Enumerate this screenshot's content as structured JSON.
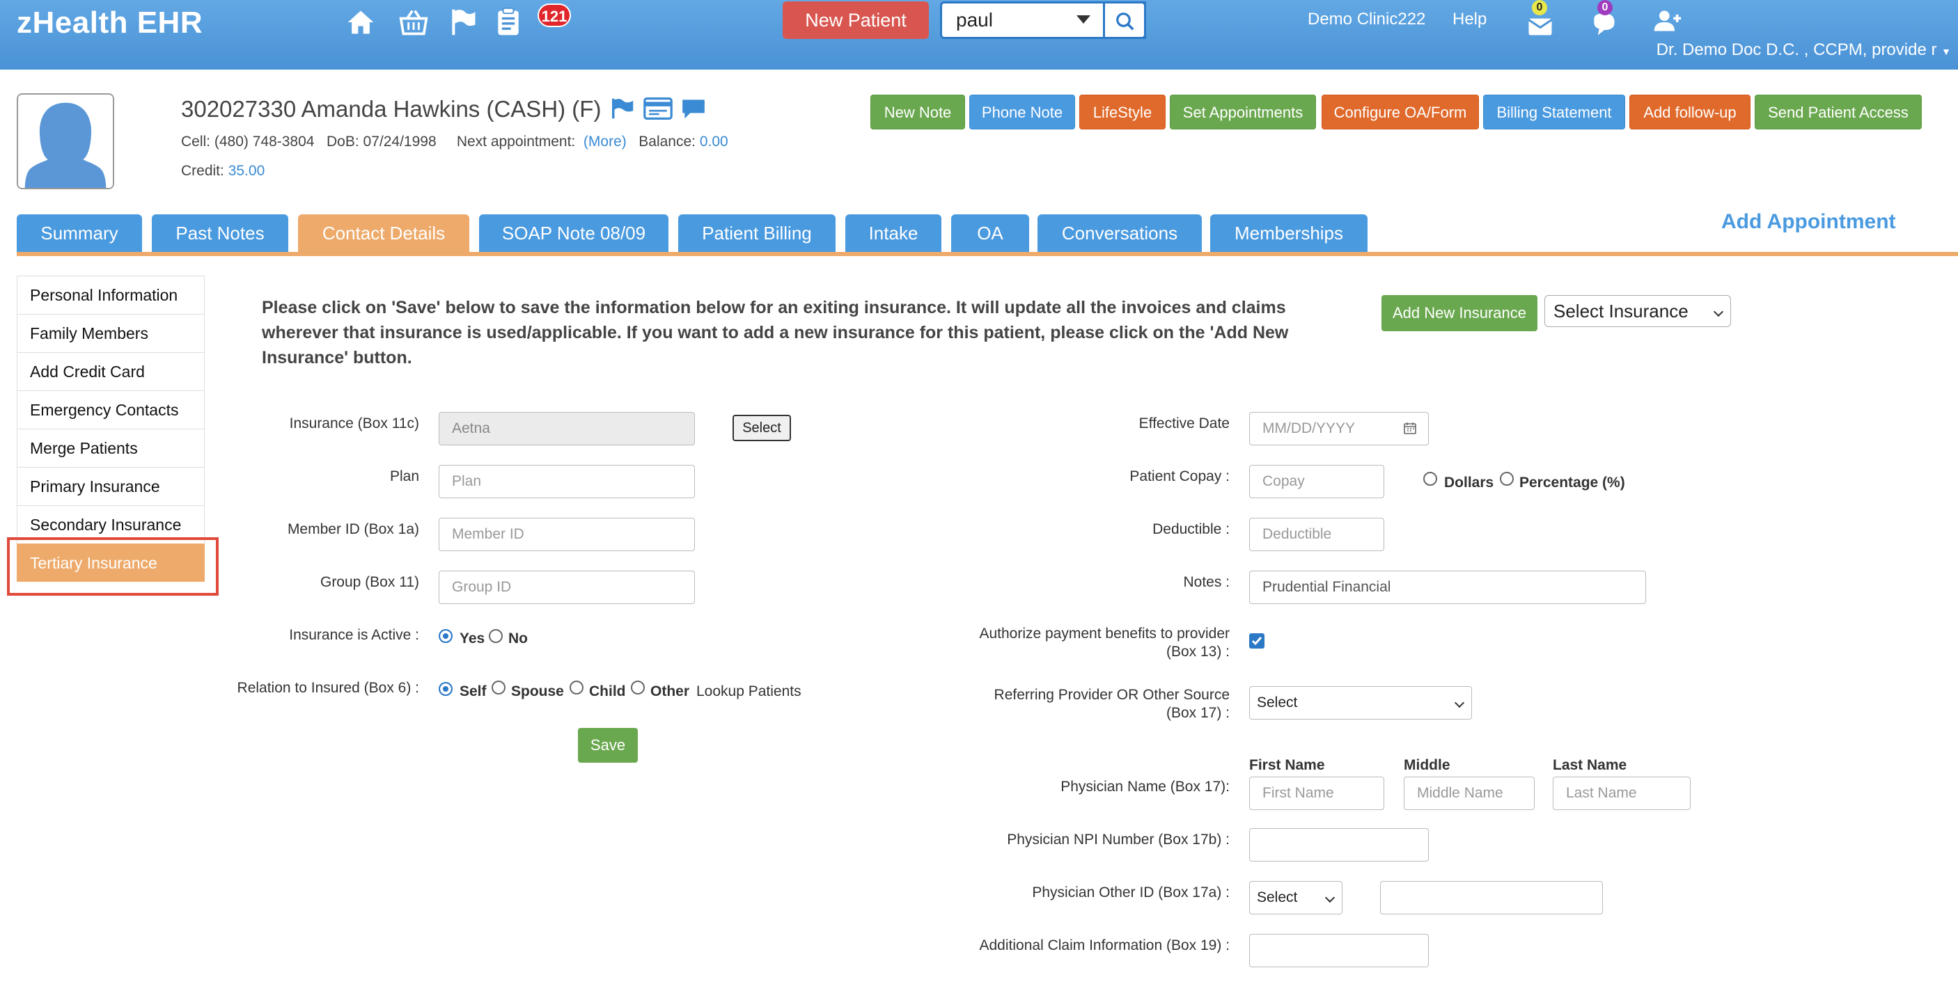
{
  "app": {
    "brand": "zHealth EHR"
  },
  "topbar": {
    "icons": [
      "home-icon",
      "basket-icon",
      "flag-icon",
      "clipboard-icon"
    ],
    "notification_count": "121",
    "new_patient": "New Patient",
    "search_value": "paul",
    "clinic": "Demo Clinic222",
    "help": "Help",
    "mail_count": "0",
    "chat_count": "0",
    "provider": "Dr. Demo Doc D.C. , CCPM, provide r"
  },
  "patient": {
    "header": "302027330 Amanda Hawkins  (CASH) (F)",
    "cell_label": "Cell:",
    "cell": "(480) 748-3804",
    "dob_label": "DoB:",
    "dob": "07/24/1998",
    "next_appt_label": "Next appointment:",
    "next_appt_link": "(More)",
    "balance_label": "Balance:",
    "balance": "0.00",
    "credit_label": "Credit:",
    "credit": "35.00"
  },
  "actions": {
    "new_note": "New Note",
    "phone_note": "Phone Note",
    "lifestyle": "LifeStyle",
    "set_appointments": "Set Appointments",
    "configure": "Configure OA/Form",
    "billing_statement": "Billing Statement",
    "add_followup": "Add follow-up",
    "send_access": "Send Patient Access"
  },
  "tabs": [
    "Summary",
    "Past Notes",
    "Contact Details",
    "SOAP Note 08/09",
    "Patient Billing",
    "Intake",
    "OA",
    "Conversations",
    "Memberships"
  ],
  "add_appointment": "Add Appointment",
  "side_menu": [
    "Personal Information",
    "Family Members",
    "Add Credit Card",
    "Emergency Contacts",
    "Merge Patients",
    "Primary Insurance",
    "Secondary Insurance",
    "Tertiary Insurance"
  ],
  "instructions": "Please click on 'Save' below to save the information below for an exiting insurance. It will update all the invoices and claims wherever that insurance is used/applicable. If you want to add a new insurance for this patient, please click on the 'Add New Insurance' button.",
  "add_new_insurance": "Add New Insurance",
  "select_insurance": "Select Insurance",
  "form_left": {
    "insurance_label": "Insurance (Box 11c)",
    "insurance_value": "Aetna",
    "select_button": "Select",
    "plan_label": "Plan",
    "plan_placeholder": "Plan",
    "member_label": "Member ID (Box 1a)",
    "member_placeholder": "Member ID",
    "group_label": "Group (Box 11)",
    "group_placeholder": "Group ID",
    "active_label": "Insurance is Active :",
    "yes": "Yes",
    "no": "No",
    "relation_label": "Relation to Insured (Box 6) :",
    "self": "Self",
    "spouse": "Spouse",
    "child": "Child",
    "other": "Other",
    "lookup": "Lookup Patients",
    "save": "Save"
  },
  "form_right": {
    "effective_label": "Effective Date",
    "effective_placeholder": "MM/DD/YYYY",
    "copay_label": "Patient Copay :",
    "copay_placeholder": "Copay",
    "dollars": "Dollars",
    "percentage": "Percentage (%)",
    "deductible_label": "Deductible :",
    "deductible_placeholder": "Deductible",
    "notes_label": "Notes :",
    "notes_value": "Prudential Financial",
    "authorize_label_1": "Authorize payment benefits to provider",
    "authorize_label_2": "(Box 13) :",
    "referring_label_1": "Referring Provider OR Other Source",
    "referring_label_2": "(Box 17) :",
    "referring_value": "Select",
    "first_name_head": "First Name",
    "middle_head": "Middle",
    "last_name_head": "Last Name",
    "physician_label": "Physician Name (Box 17):",
    "first_name_placeholder": "First Name",
    "middle_placeholder": "Middle Name",
    "last_name_placeholder": "Last Name",
    "npi_label": "Physician NPI Number (Box 17b) :",
    "other_id_label": "Physician Other ID (Box 17a) :",
    "other_id_select": "Select",
    "claim_label": "Additional Claim Information (Box 19) :"
  }
}
